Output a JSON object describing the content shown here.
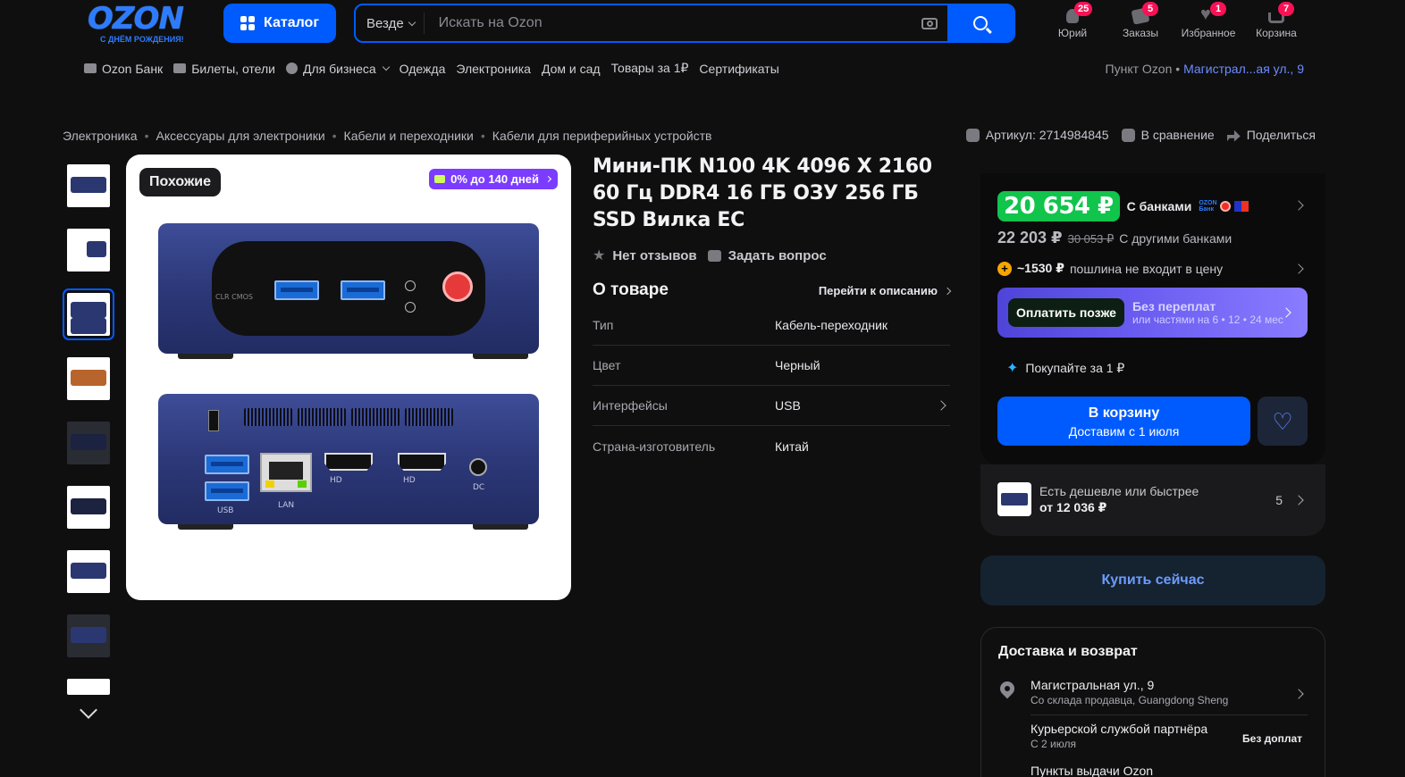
{
  "header": {
    "logo_text": "OZON",
    "logo_sub": "С ДНЁМ РОЖДЕНИЯ!",
    "catalog_label": "Каталог",
    "search_scope": "Везде",
    "search_placeholder": "Искать на Ozon",
    "actions": [
      {
        "label": "Юрий",
        "badge": "25",
        "icon": "user-icon"
      },
      {
        "label": "Заказы",
        "badge": "5",
        "icon": "orders-icon"
      },
      {
        "label": "Избранное",
        "badge": "1",
        "icon": "heart-icon"
      },
      {
        "label": "Корзина",
        "badge": "7",
        "icon": "cart-icon"
      }
    ]
  },
  "subnav": {
    "items": [
      {
        "label": "Ozon Банк",
        "icon": "bank-card-icon"
      },
      {
        "label": "Билеты, отели",
        "icon": "plane-icon"
      },
      {
        "label": "Для бизнеса",
        "icon": "business-icon",
        "dropdown": true
      },
      {
        "label": "Одежда"
      },
      {
        "label": "Электроника"
      },
      {
        "label": "Дом и сад"
      },
      {
        "label": "Товары за 1₽"
      },
      {
        "label": "Сертификаты"
      }
    ],
    "pickup_prefix": "Пункт Ozon •",
    "pickup_address": "Магистрал...ая ул., 9"
  },
  "breadcrumbs": [
    "Электроника",
    "Аксессуары для электроники",
    "Кабели и переходники",
    "Кабели для периферийных устройств"
  ],
  "meta": {
    "article": "Артикул: 2714984845",
    "compare": "В сравнение",
    "share": "Поделиться"
  },
  "gallery": {
    "similar_label": "Похожие",
    "installment_badge": "0% до 140 дней",
    "labels": {
      "clr_cmos": "CLR CMOS",
      "usb": "USB",
      "lan": "LAN",
      "hd1": "HD",
      "hd2": "HD",
      "dc": "DC"
    }
  },
  "product": {
    "title": "Мини-ПК N100 4K 4096 X 2160 60 Гц DDR4 16 ГБ ОЗУ 256 ГБ SSD Вилка ЕС",
    "reviews": "Нет отзывов",
    "ask": "Задать вопрос",
    "about_title": "О товаре",
    "about_link": "Перейти к описанию",
    "specs": [
      {
        "key": "Тип",
        "value": "Кабель-переходник"
      },
      {
        "key": "Цвет",
        "value": "Черный"
      },
      {
        "key": "Интерфейсы",
        "value": "USB"
      },
      {
        "key": "Страна-изготовитель",
        "value": "Китай"
      }
    ]
  },
  "buy": {
    "price": "20 654 ₽",
    "price_note": "С банками",
    "bank_logo_text": "OZON Банк",
    "price_other": "22 203 ₽",
    "price_old": "30 053 ₽",
    "price_other_note": "С другими банками",
    "duty_amount": "~1530 ₽",
    "duty_note": "пошлина не входит в цену",
    "paylater_btn": "Оплатить позже",
    "paylater_t1": "Без переплат",
    "paylater_t2": "или частями на 6 • 12 • 24 мес",
    "buy_for_1": "Покупайте за 1 ₽",
    "cart_l1": "В корзину",
    "cart_l2": "Доставим с 1 июля"
  },
  "cheaper": {
    "line1": "Есть дешевле или быстрее",
    "line2": "от 12 036 ₽",
    "count": "5"
  },
  "buy_now": "Купить сейчас",
  "delivery": {
    "title": "Доставка и возврат",
    "rows": [
      {
        "title": "Магистральная ул., 9",
        "sub": "Со склада продавца, Guangdong Sheng",
        "right": ""
      },
      {
        "title": "Курьерской службой партнёра",
        "sub": "С 2 июля",
        "right": "Без доплат"
      },
      {
        "title": "Пункты выдачи Ozon",
        "sub": "",
        "right": ""
      }
    ]
  },
  "colors": {
    "accent": "#005bff",
    "price_green": "#10c44c",
    "badge_pink": "#f91155",
    "installment_purple": "#7c3cff"
  }
}
